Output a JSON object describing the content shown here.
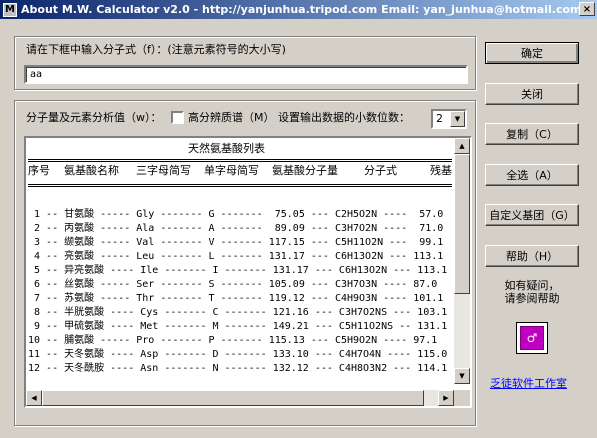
{
  "window": {
    "title": "About M.W. Calculator v2.0 - http://yanjunhua.tripod.com Email: yan_junhua@hotmail.com",
    "close_glyph": "×"
  },
  "formula": {
    "label": "请在下框中输入分子式（f）：(注意元素符号的大小写)",
    "value": "aa"
  },
  "analysis": {
    "label": "分子量及元素分析值（w）：",
    "hires_label": "高分辨质谱（M）",
    "decimals_label": "设置输出数据的小数位数：",
    "decimals_value": "2"
  },
  "list": {
    "heading": "天然氨基酸列表",
    "rule": "==============================================================================",
    "columns": [
      "序号",
      "氨基酸名称",
      "三字母简写",
      "单字母简写",
      "氨基酸分子量",
      "分子式",
      "残基"
    ],
    "rows": [
      " 1 -- 甘氨酸 ----- Gly ------- G -------  75.05 --- C2H5O2N ----  57.0",
      " 2 -- 丙氨酸 ----- Ala ------- A -------  89.09 --- C3H7O2N ----  71.0",
      " 3 -- 缬氨酸 ----- Val ------- V ------- 117.15 --- C5H11O2N ---  99.1",
      " 4 -- 亮氨酸 ----- Leu ------- L ------- 131.17 --- C6H13O2N --- 113.1",
      " 5 -- 异亮氨酸 ---- Ile ------- I ------- 131.17 --- C6H13O2N --- 113.1",
      " 6 -- 丝氨酸 ----- Ser ------- S ------- 105.09 --- C3H7O3N ---- 87.0",
      " 7 -- 苏氨酸 ----- Thr ------- T ------- 119.12 --- C4H9O3N ---- 101.1",
      " 8 -- 半胱氨酸 ---- Cys ------- C ------- 121.16 --- C3H7O2NS --- 103.1",
      " 9 -- 甲硫氨酸 ---- Met ------- M ------- 149.21 --- C5H11O2NS -- 131.1",
      "10 -- 脯氨酸 ----- Pro ------- P ------- 115.13 --- C5H9O2N ---- 97.1",
      "11 -- 天冬氨酸 ---- Asp ------- D ------- 133.10 --- C4H7O4N ---- 115.0",
      "12 -- 天冬酰胺 ---- Asn ------- N ------- 132.12 --- C4H8O3N2 --- 114.1"
    ]
  },
  "buttons": {
    "ok": "确定",
    "close": "关闭",
    "copy": "复制（C）",
    "select_all": "全选（A）",
    "custom_group": "自定义基团（G）",
    "help": "帮助（H）"
  },
  "help_text": {
    "line1": "如有疑问，",
    "line2": "请参阅帮助"
  },
  "icon_glyph": "♂",
  "studio_link": "乏徒软件工作室",
  "scroll_glyphs": {
    "up": "▲",
    "down": "▼",
    "left": "◀",
    "right": "▶"
  }
}
